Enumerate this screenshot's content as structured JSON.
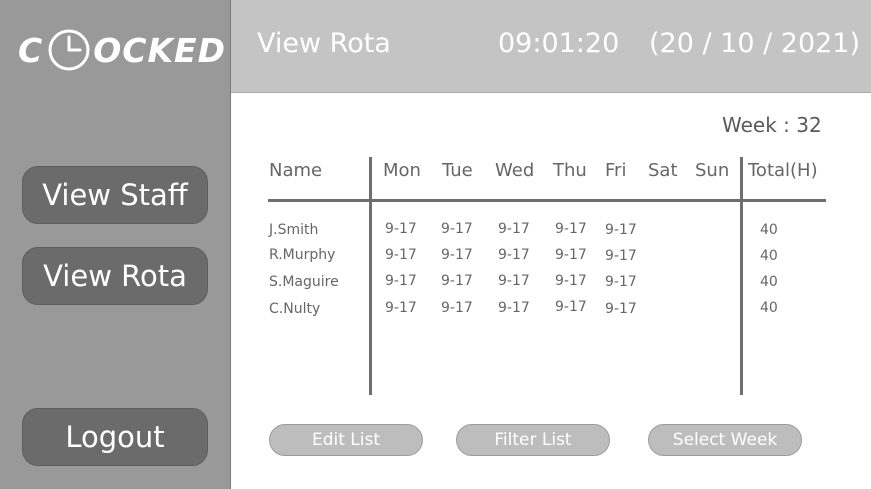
{
  "logo": {
    "text_before": "C",
    "text_after": "OCKED",
    "icon": "clock-icon"
  },
  "sidebar": {
    "buttons": [
      {
        "label": "View Staff"
      },
      {
        "label": "View Rota"
      },
      {
        "label": "Logout"
      }
    ]
  },
  "header": {
    "title": "View Rota",
    "time": "09:01:20",
    "date": "(20 / 10 / 2021)"
  },
  "week_label": "Week : 32",
  "table": {
    "columns": [
      "Name",
      "Mon",
      "Tue",
      "Wed",
      "Thu",
      "Fri",
      "Sat",
      "Sun",
      "Total(H)"
    ],
    "rows": [
      {
        "name": "J.Smith",
        "mon": "9-17",
        "tue": "9-17",
        "wed": "9-17",
        "thu": "9-17",
        "fri": "9-17",
        "sat": "",
        "sun": "",
        "total": "40"
      },
      {
        "name": "R.Murphy",
        "mon": "9-17",
        "tue": "9-17",
        "wed": "9-17",
        "thu": "9-17",
        "fri": "9-17",
        "sat": "",
        "sun": "",
        "total": "40"
      },
      {
        "name": "S.Maguire",
        "mon": "9-17",
        "tue": "9-17",
        "wed": "9-17",
        "thu": "9-17",
        "fri": "9-17",
        "sat": "",
        "sun": "",
        "total": "40"
      },
      {
        "name": "C.Nulty",
        "mon": "9-17",
        "tue": "9-17",
        "wed": "9-17",
        "thu": "9-17",
        "fri": "9-17",
        "sat": "",
        "sun": "",
        "total": "40"
      }
    ]
  },
  "actions": {
    "edit": "Edit List",
    "filter": "Filter List",
    "select_week": "Select Week"
  },
  "colors": {
    "sidebar_bg": "#999999",
    "button_dark": "#6b6b6b",
    "header_bg": "#c4c4c4",
    "button_light": "#bdbdbd"
  }
}
